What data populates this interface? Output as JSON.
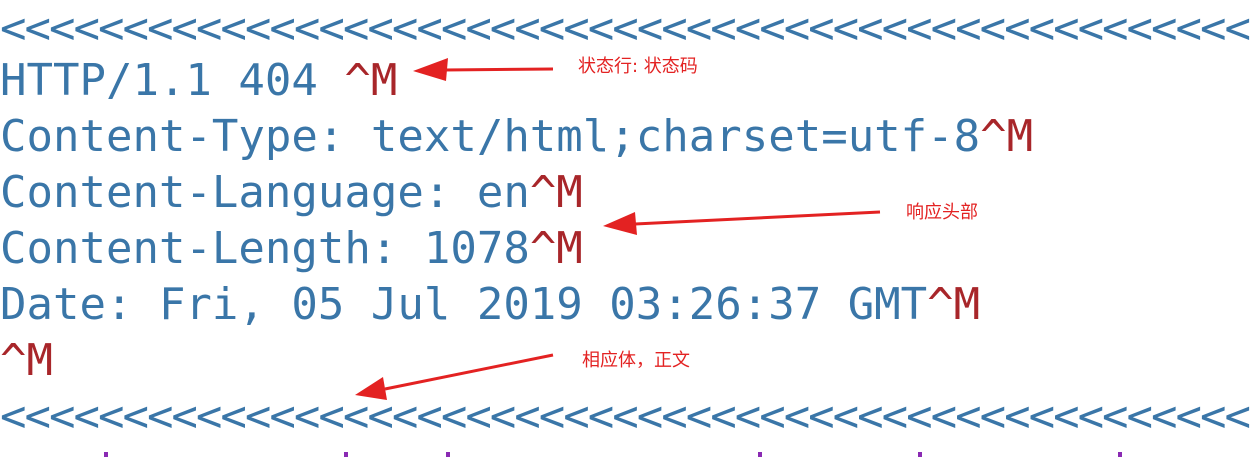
{
  "response": {
    "separator": "<<<<<<<<<<<<<<<<<<<<<<<<<<<<<<<<<<<<<<<<<<<<<<<<<<<<<<<<<<<<<<<<<<<<<<<<<<<<<<<<<<<<<<<<<<<<<",
    "status_line": "HTTP/1.1 404 ",
    "content_type": "Content-Type: text/html;charset=utf-8",
    "content_language": "Content-Language: en",
    "content_length": "Content-Length: 1078",
    "date": "Date: Fri, 05 Jul 2019 03:26:37 GMT",
    "cr_marker": "^M"
  },
  "annotations": {
    "status": "状态行: 状态码",
    "header": "响应头部",
    "body": "相应体，正文"
  },
  "colors": {
    "code_text": "#3a76a8",
    "carriage_return": "#a8262a",
    "annotation": "#e32222",
    "next_line_fragment": "#8a2ab3"
  }
}
